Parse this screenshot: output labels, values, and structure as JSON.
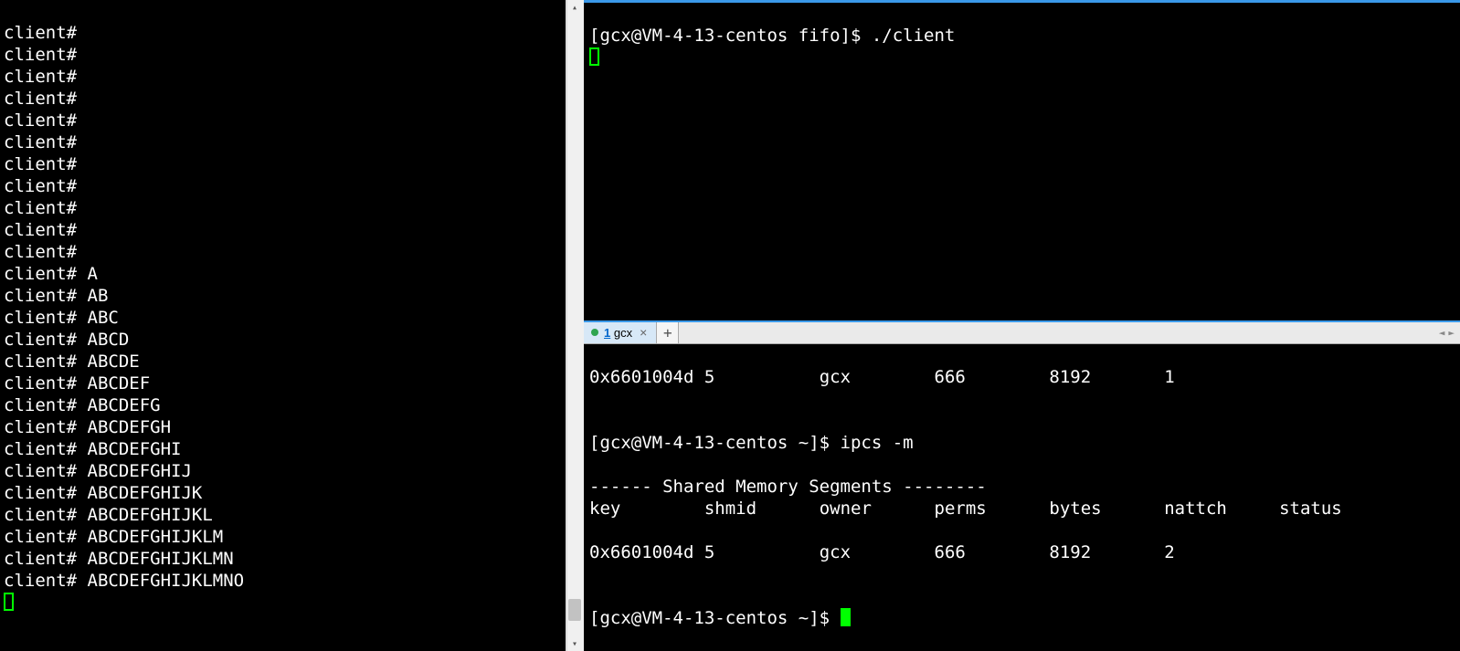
{
  "left": {
    "lines": [
      "client# ",
      "client# ",
      "client# ",
      "client# ",
      "client# ",
      "client# ",
      "client# ",
      "client# ",
      "client# ",
      "client# ",
      "client# ",
      "client# A",
      "client# AB",
      "client# ABC",
      "client# ABCD",
      "client# ABCDE",
      "client# ABCDEF",
      "client# ABCDEFG",
      "client# ABCDEFGH",
      "client# ABCDEFGHI",
      "client# ABCDEFGHIJ",
      "client# ABCDEFGHIJK",
      "client# ABCDEFGHIJKL",
      "client# ABCDEFGHIJKLM",
      "client# ABCDEFGHIJKLMN",
      "client# ABCDEFGHIJKLMNO"
    ]
  },
  "topRight": {
    "prompt": "[gcx@VM-4-13-centos fifo]$ ",
    "cmd": "./client"
  },
  "tab": {
    "num": "1",
    "label": "gcx"
  },
  "bottomRight": {
    "row1_key": "0x6601004d",
    "row1_shmid": "5",
    "row1_owner": "gcx",
    "row1_perms": "666",
    "row1_bytes": "8192",
    "row1_nattch": "1",
    "prompt2": "[gcx@VM-4-13-centos ~]$ ",
    "cmd2": "ipcs -m",
    "heading": "------ Shared Memory Segments --------",
    "hdr_key": "key",
    "hdr_shmid": "shmid",
    "hdr_owner": "owner",
    "hdr_perms": "perms",
    "hdr_bytes": "bytes",
    "hdr_nattch": "nattch",
    "hdr_status": "status",
    "row2_key": "0x6601004d",
    "row2_shmid": "5",
    "row2_owner": "gcx",
    "row2_perms": "666",
    "row2_bytes": "8192",
    "row2_nattch": "2",
    "prompt3": "[gcx@VM-4-13-centos ~]$ "
  }
}
